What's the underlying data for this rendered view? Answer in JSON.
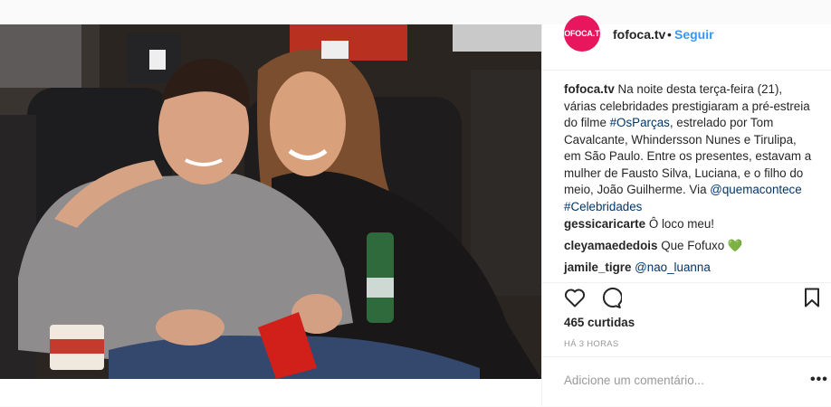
{
  "post": {
    "username": "fofoca.tv",
    "avatar_text": "FOFOCA.TV",
    "follow_label": "Seguir",
    "dot": "•",
    "caption": {
      "user": "fofoca.tv",
      "part1": " Na noite desta terça-feira (21), várias celebridades prestigiaram a pré-estreia do filme ",
      "hashtag1": "#OsParças",
      "part2": ", estrelado por Tom Cavalcante, Whindersson Nunes e Tirulipa, em São Paulo. Entre os presentes, estavam a mulher de Fausto Silva, Luciana, e o filho do meio, João Guilherme. Via ",
      "mention": "@quemacontece",
      "space": " ",
      "hashtag2": "#Celebridades"
    },
    "comments": [
      {
        "user": "gessicaricarte",
        "text": " Ô loco meu!"
      },
      {
        "user": "cleyamaededois",
        "text": " Que Fofuxo ",
        "emoji": "💚"
      },
      {
        "user": "jamile_tigre",
        "text": " ",
        "mention": "@nao_luanna"
      }
    ],
    "likes": "465 curtidas",
    "time": "HÁ 3 HORAS",
    "add_comment_placeholder": "Adicione um comentário...",
    "more": "•••"
  },
  "colors": {
    "follow": "#3897f0",
    "avatar": "#e8175d",
    "link": "#003569"
  },
  "icons": [
    "heart-icon",
    "comment-icon",
    "bookmark-icon",
    "more-options-icon"
  ]
}
